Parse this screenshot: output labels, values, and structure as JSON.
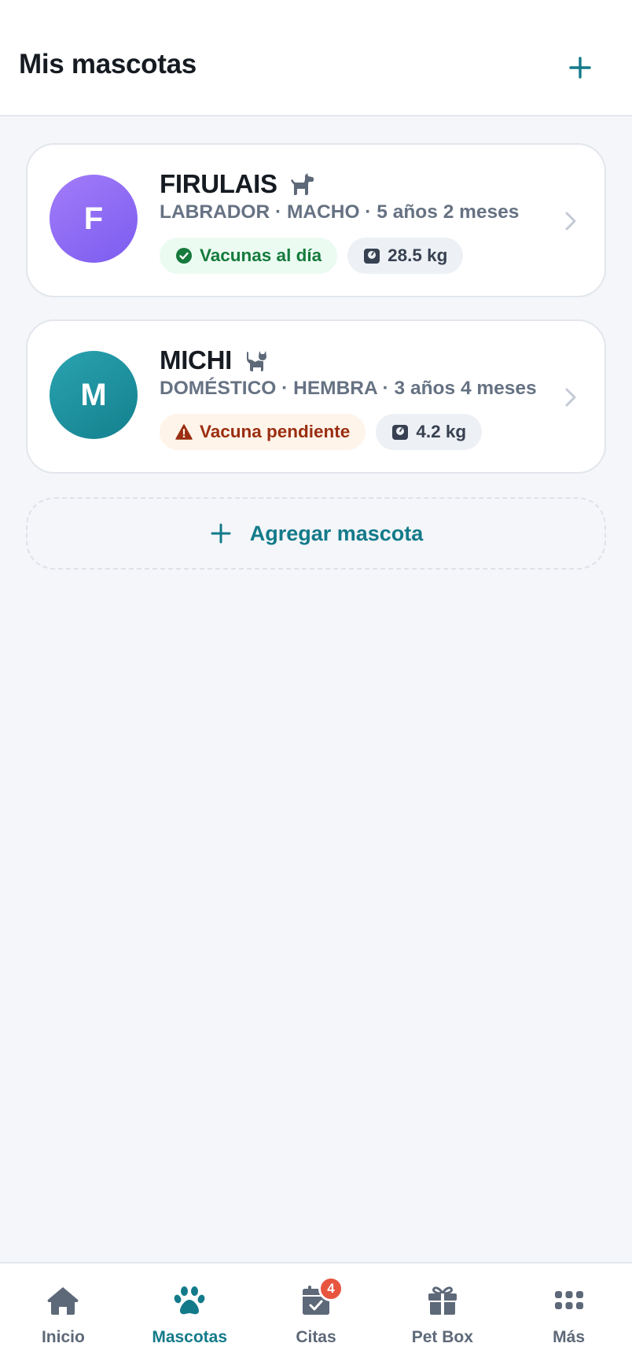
{
  "header": {
    "title": "Mis mascotas",
    "add_icon": "plus-icon"
  },
  "pets": [
    {
      "initial": "F",
      "name": "FIRULAIS",
      "species_icon": "dog-icon",
      "meta": "LABRADOR · MACHO · 5 años 2 meses",
      "vaccine_status": "Vacunas al día",
      "vaccine_icon": "check-circle-icon",
      "weight": "28.5 kg",
      "weight_icon": "scale-icon",
      "avatar_color": "#8b68f4"
    },
    {
      "initial": "M",
      "name": "MICHI",
      "species_icon": "cat-icon",
      "meta": "DOMÉSTICO · HEMBRA · 3 años 4 meses",
      "vaccine_status": "Vacuna pendiente",
      "vaccine_icon": "warning-icon",
      "weight": "4.2 kg",
      "weight_icon": "scale-icon",
      "avatar_color": "#1c8d9b"
    }
  ],
  "add_pet": {
    "label": "Agregar mascota"
  },
  "nav": [
    {
      "label": "Inicio",
      "icon": "home-icon",
      "active": false
    },
    {
      "label": "Mascotas",
      "icon": "paw-icon",
      "active": true
    },
    {
      "label": "Citas",
      "icon": "calendar-check-icon",
      "active": false,
      "badge": "4"
    },
    {
      "label": "Pet Box",
      "icon": "gift-icon",
      "active": false
    },
    {
      "label": "Más",
      "icon": "grid-dots-icon",
      "active": false
    }
  ],
  "colors": {
    "accent": "#137a8a",
    "success_text": "#157a3c",
    "success_bg": "#ecfbf2",
    "warning_text": "#9a2e10",
    "warning_bg": "#fff4ea",
    "badge": "#e8553f"
  }
}
